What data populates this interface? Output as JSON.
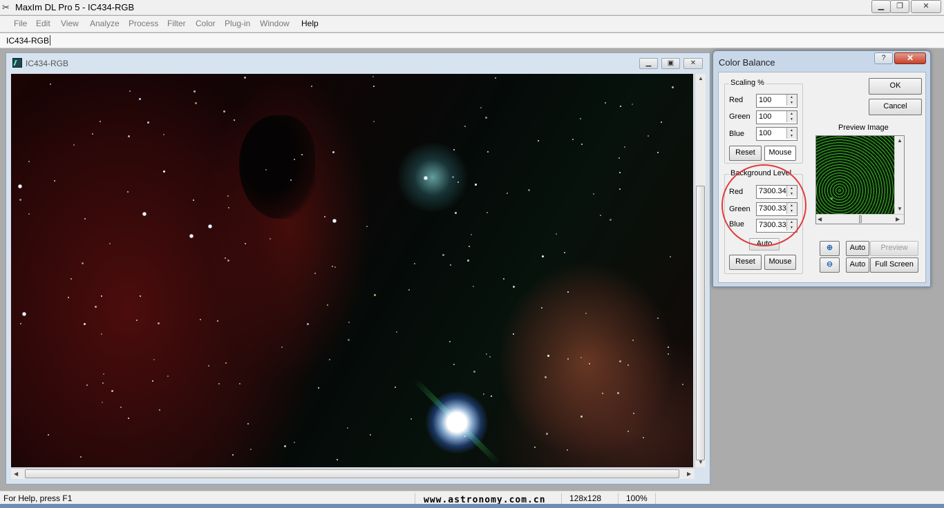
{
  "app": {
    "title": "MaxIm DL Pro 5 - IC434-RGB"
  },
  "menu": [
    "File",
    "Edit",
    "View",
    "Analyze",
    "Process",
    "Filter",
    "Color",
    "Plug-in",
    "Window",
    "Help"
  ],
  "toolbar": {
    "document": "IC434-RGB"
  },
  "image_window": {
    "title": "IC434-RGB"
  },
  "dialog": {
    "title": "Color Balance",
    "help": "?",
    "close": "✕",
    "scaling": {
      "title": "Scaling %",
      "red_label": "Red",
      "red_value": "100",
      "green_label": "Green",
      "green_value": "100",
      "blue_label": "Blue",
      "blue_value": "100",
      "reset": "Reset",
      "mouse": "Mouse"
    },
    "background": {
      "title": "Background Level",
      "red_label": "Red",
      "red_value": "7300.34",
      "green_label": "Green",
      "green_value": "7300.33",
      "blue_label": "Blue",
      "blue_value": "7300.33",
      "auto": "Auto",
      "reset": "Reset",
      "mouse": "Mouse"
    },
    "ok": "OK",
    "cancel": "Cancel",
    "preview_title": "Preview Image",
    "auto1": "Auto",
    "preview": "Preview",
    "auto2": "Auto",
    "full_screen": "Full Screen"
  },
  "status": {
    "help": "For Help, press F1",
    "watermark": "www.astronomy.com.cn",
    "size": "128x128",
    "zoom": "100%"
  }
}
